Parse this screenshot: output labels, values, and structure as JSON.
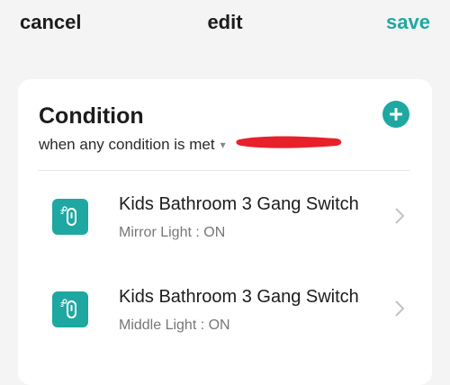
{
  "header": {
    "cancel_label": "cancel",
    "title": "edit",
    "save_label": "save"
  },
  "condition": {
    "title": "Condition",
    "mode_label": "when any condition is met",
    "items": [
      {
        "device_name": "Kids Bathroom 3 Gang Switch",
        "status": "Mirror Light : ON",
        "icon": "switch-icon"
      },
      {
        "device_name": "Kids Bathroom 3 Gang Switch",
        "status": "Middle Light : ON",
        "icon": "switch-icon"
      }
    ]
  },
  "colors": {
    "accent": "#1fa8a2",
    "background": "#f4f4f4",
    "card": "#ffffff",
    "redaction": "#e8202a"
  }
}
